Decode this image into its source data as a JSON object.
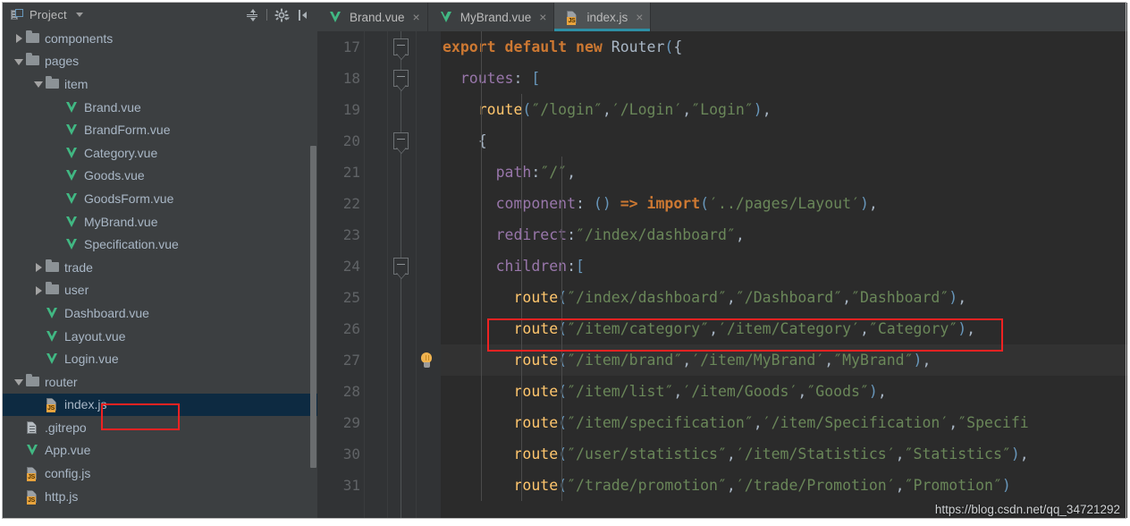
{
  "sidebar": {
    "title": "Project",
    "icon": "project-icon",
    "tools": [
      {
        "name": "collapse-all-icon",
        "label": "Collapse All"
      },
      {
        "name": "settings-gear-icon",
        "label": "Settings"
      },
      {
        "name": "hide-panel-icon",
        "label": "Hide"
      }
    ],
    "tree": [
      {
        "label": "components",
        "icon": "folder-icon",
        "twisty": "closed",
        "indent": 1,
        "selected": false
      },
      {
        "label": "pages",
        "icon": "folder-icon",
        "twisty": "open",
        "indent": 1,
        "selected": false
      },
      {
        "label": "item",
        "icon": "folder-icon",
        "twisty": "open",
        "indent": 2,
        "selected": false
      },
      {
        "label": "Brand.vue",
        "icon": "vue-file-icon",
        "twisty": "none",
        "indent": 3,
        "selected": false
      },
      {
        "label": "BrandForm.vue",
        "icon": "vue-file-icon",
        "twisty": "none",
        "indent": 3,
        "selected": false
      },
      {
        "label": "Category.vue",
        "icon": "vue-file-icon",
        "twisty": "none",
        "indent": 3,
        "selected": false
      },
      {
        "label": "Goods.vue",
        "icon": "vue-file-icon",
        "twisty": "none",
        "indent": 3,
        "selected": false
      },
      {
        "label": "GoodsForm.vue",
        "icon": "vue-file-icon",
        "twisty": "none",
        "indent": 3,
        "selected": false
      },
      {
        "label": "MyBrand.vue",
        "icon": "vue-file-icon",
        "twisty": "none",
        "indent": 3,
        "selected": false
      },
      {
        "label": "Specification.vue",
        "icon": "vue-file-icon",
        "twisty": "none",
        "indent": 3,
        "selected": false
      },
      {
        "label": "trade",
        "icon": "folder-icon",
        "twisty": "closed",
        "indent": 2,
        "selected": false
      },
      {
        "label": "user",
        "icon": "folder-icon",
        "twisty": "closed",
        "indent": 2,
        "selected": false
      },
      {
        "label": "Dashboard.vue",
        "icon": "vue-file-icon",
        "twisty": "none",
        "indent": 2,
        "selected": false
      },
      {
        "label": "Layout.vue",
        "icon": "vue-file-icon",
        "twisty": "none",
        "indent": 2,
        "selected": false
      },
      {
        "label": "Login.vue",
        "icon": "vue-file-icon",
        "twisty": "none",
        "indent": 2,
        "selected": false
      },
      {
        "label": "router",
        "icon": "folder-icon",
        "twisty": "open",
        "indent": 1,
        "selected": false
      },
      {
        "label": "index.js",
        "icon": "js-file-icon",
        "twisty": "none",
        "indent": 2,
        "selected": true,
        "highlighted": true
      },
      {
        "label": ".gitrepo",
        "icon": "plain-file-icon",
        "twisty": "none",
        "indent": 1,
        "selected": false
      },
      {
        "label": "App.vue",
        "icon": "vue-file-icon",
        "twisty": "none",
        "indent": 1,
        "selected": false
      },
      {
        "label": "config.js",
        "icon": "js-file-icon",
        "twisty": "none",
        "indent": 1,
        "selected": false
      },
      {
        "label": "http.js",
        "icon": "js-file-icon",
        "twisty": "none",
        "indent": 1,
        "selected": false
      }
    ]
  },
  "tabs": [
    {
      "label": "Brand.vue",
      "icon": "vue-file-icon",
      "close": "×",
      "active": false
    },
    {
      "label": "MyBrand.vue",
      "icon": "vue-file-icon",
      "close": "×",
      "active": false
    },
    {
      "label": "index.js",
      "icon": "js-file-icon",
      "close": "×",
      "active": true
    }
  ],
  "editor": {
    "active_file": "index.js",
    "first_line": 17,
    "lines": [
      {
        "n": "17",
        "fold": true,
        "bulb": false,
        "text": "export default new Router({"
      },
      {
        "n": "18",
        "fold": true,
        "bulb": false,
        "text": "  routes: ["
      },
      {
        "n": "19",
        "fold": false,
        "bulb": false,
        "text": "    route(″/login″,′/Login′,″Login″),"
      },
      {
        "n": "20",
        "fold": true,
        "bulb": false,
        "text": "    {"
      },
      {
        "n": "21",
        "fold": false,
        "bulb": false,
        "text": "      path:″/″,"
      },
      {
        "n": "22",
        "fold": false,
        "bulb": false,
        "text": "      component: () => import(′../pages/Layout′),"
      },
      {
        "n": "23",
        "fold": false,
        "bulb": false,
        "text": "      redirect:″/index/dashboard″,"
      },
      {
        "n": "24",
        "fold": true,
        "bulb": false,
        "text": "      children:["
      },
      {
        "n": "25",
        "fold": false,
        "bulb": false,
        "text": "        route(″/index/dashboard″,″/Dashboard″,″Dashboard″),"
      },
      {
        "n": "26",
        "fold": false,
        "bulb": false,
        "text": "        route(″/item/category″,′/item/Category′,″Category″),"
      },
      {
        "n": "27",
        "fold": false,
        "bulb": true,
        "text": "        route(″/item/brand″,′/item/MyBrand′,″MyBrand″),",
        "current": true,
        "highlighted": true
      },
      {
        "n": "28",
        "fold": false,
        "bulb": false,
        "text": "        route(″/item/list″,′/item/Goods′,″Goods″),"
      },
      {
        "n": "29",
        "fold": false,
        "bulb": false,
        "text": "        route(″/item/specification″,′/item/Specification′,″Specifi"
      },
      {
        "n": "30",
        "fold": false,
        "bulb": false,
        "text": "        route(″/user/statistics″,′/item/Statistics′,″Statistics″),"
      },
      {
        "n": "31",
        "fold": false,
        "bulb": false,
        "text": "        route(″/trade/promotion″,′/trade/Promotion′,″Promotion″)"
      }
    ]
  },
  "watermark": "https://blog.csdn.net/qq_34721292",
  "colors": {
    "sidebar_bg": "#3c3f41",
    "editor_bg": "#2b2b2b",
    "gutter_bg": "#313335",
    "selection_bg": "#0d2a41",
    "tab_active_bg": "#4e5254",
    "tab_underline": "#2d8fa5",
    "highlight_box": "#ef2222",
    "vue_green": "#41b883",
    "keyword": "#cc7832",
    "string": "#6a8759",
    "function": "#ffc66d",
    "property": "#9876aa",
    "bracket": "#6897bb",
    "text": "#a9b7c6"
  }
}
